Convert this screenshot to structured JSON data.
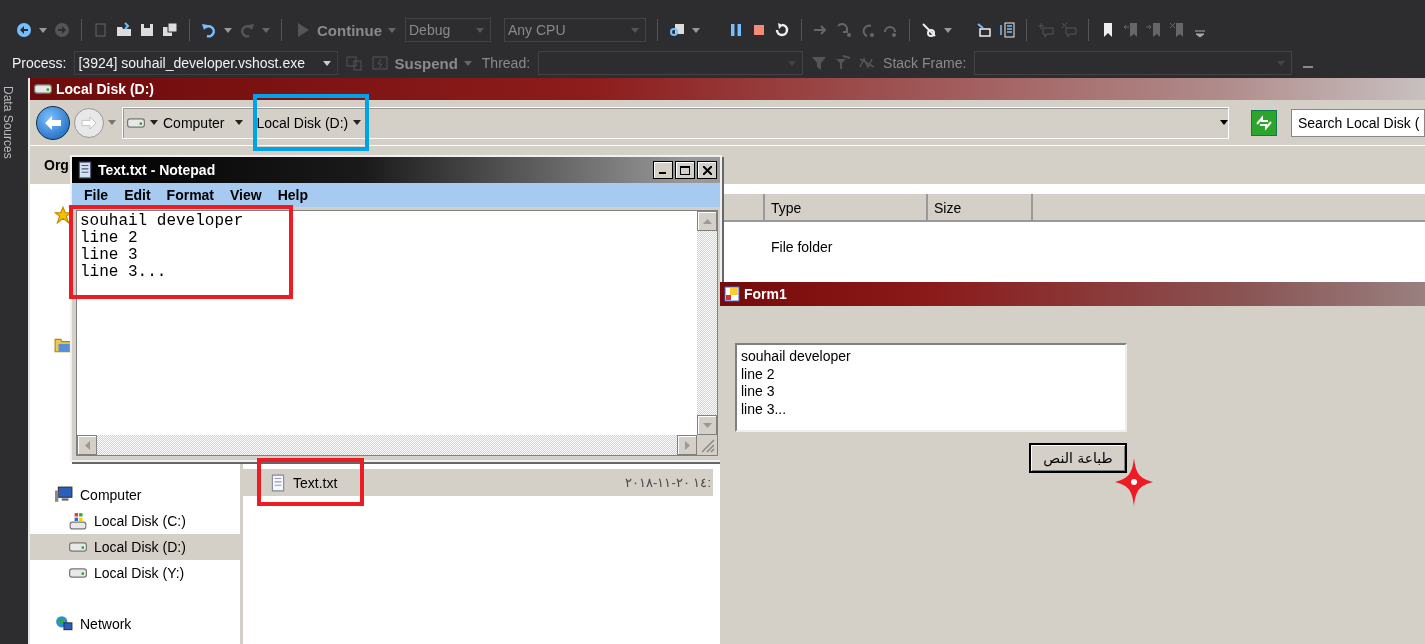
{
  "ide_toolbar": {
    "continue": "Continue",
    "configuration": "Debug",
    "platform": "Any CPU"
  },
  "debug_location": {
    "process_label": "Process:",
    "process": "[3924] souhail_developer.vshost.exe",
    "suspend": "Suspend",
    "thread_label": "Thread:",
    "stack_frame_label": "Stack Frame:"
  },
  "side_tab": "Data Sources",
  "explorer": {
    "title": "Local Disk (D:)",
    "breadcrumb": [
      "Computer",
      "Local Disk (D:)"
    ],
    "search": {
      "placeholder": "Search Local Disk ("
    },
    "toolbar_button": "Org",
    "nav": [
      {
        "label": "Computer",
        "kind": "computer",
        "selected": false,
        "children": [
          {
            "label": "Local Disk (C:)",
            "kind": "system_drive",
            "selected": false
          },
          {
            "label": "Local Disk (D:)",
            "kind": "drive",
            "selected": true
          },
          {
            "label": "Local Disk (Y:)",
            "kind": "drive",
            "selected": false
          }
        ]
      },
      {
        "label": "Network",
        "kind": "network",
        "selected": false
      }
    ],
    "columns": [
      "Type",
      "Size"
    ],
    "folder_rows": [
      {
        "type": "File folder"
      }
    ],
    "files": [
      {
        "name": "Text.txt",
        "modified": "٢٠١٨-١١-٢٠ ١٤:",
        "selected": true
      }
    ]
  },
  "notepad": {
    "title": "Text.txt - Notepad",
    "menu": [
      "File",
      "Edit",
      "Format",
      "View",
      "Help"
    ],
    "lines": [
      "souhail developer",
      "line 2",
      "line 3",
      "line 3..."
    ]
  },
  "form": {
    "title": "Form1",
    "lines": [
      "souhail developer",
      "line 2",
      "line 3",
      "line 3..."
    ],
    "button": "طباعة النص"
  }
}
